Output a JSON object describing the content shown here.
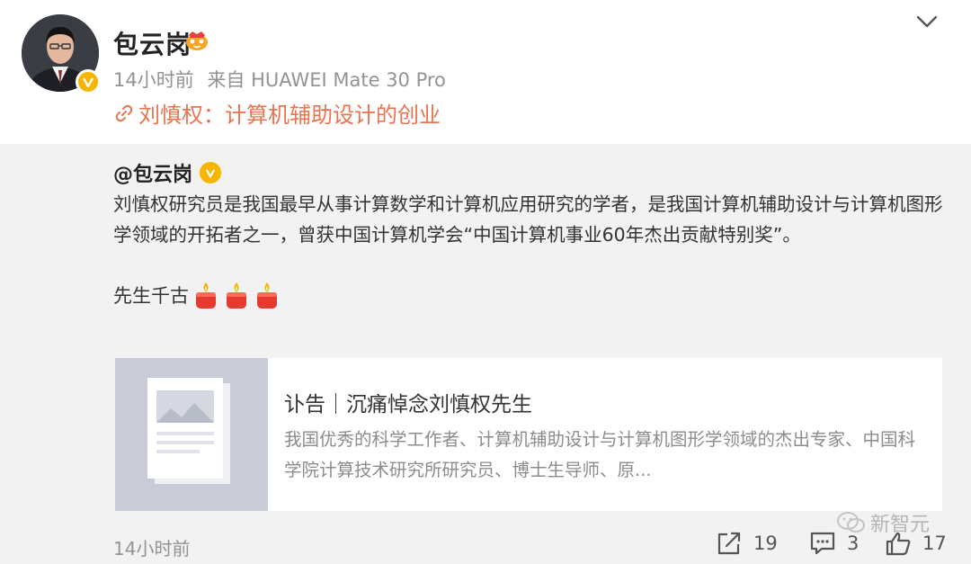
{
  "post": {
    "author": "包云岗",
    "meta": {
      "time": "14小时前",
      "source": "来自 HUAWEI Mate 30 Pro"
    },
    "title_link": "刘慎权：计算机辅助设计的创业",
    "mention": "@包云岗",
    "text": "刘慎权研究员是我国最早从事计算数学和计算机应用研究的学者，是我国计算机辅助设计与计算机图形学领域的开拓者之一，曾获中国计算机学会“中国计算机事业60年杰出贡献特别奖”。",
    "closing": "先生千古"
  },
  "card": {
    "title": "讣告｜沉痛悼念刘慎权先生",
    "description": "我国优秀的科学工作者、计算机辅助设计与计算机图形学领域的杰出专家、中国科学院计算技术研究所研究员、博士生导师、原..."
  },
  "footer": {
    "time": "14小时前",
    "repost_count": "19",
    "comment_count": "3",
    "like_count": "17"
  },
  "watermark": "新智元",
  "icons": {
    "verified": "verified-v-icon",
    "link": "link-icon",
    "candle": "candle-emoji-icon",
    "repost": "repost-icon",
    "comment": "comment-icon",
    "like": "thumbs-up-icon",
    "menu": "chevron-down-icon"
  },
  "colors": {
    "link": "#eb7350",
    "verified": "#f7b500",
    "meta_gray": "#939393",
    "background": "#f2f2f2"
  }
}
